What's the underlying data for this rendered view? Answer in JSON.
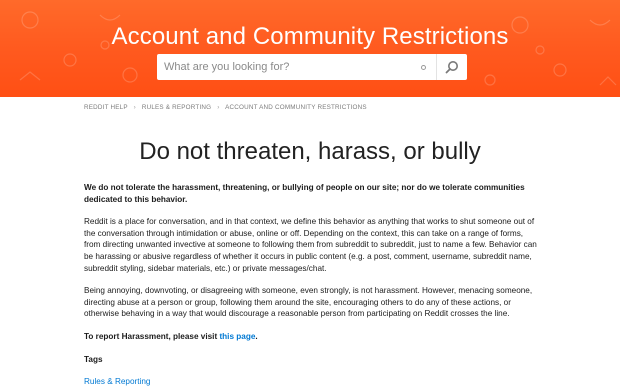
{
  "hero": {
    "title": "Account and Community Restrictions",
    "search_placeholder": "What are you looking for?",
    "search_icon": "magnifier-icon",
    "accent": "#ff5a1f"
  },
  "breadcrumb": {
    "items": [
      "REDDIT HELP",
      "RULES & REPORTING",
      "ACCOUNT AND COMMUNITY RESTRICTIONS"
    ],
    "separator": "›"
  },
  "article": {
    "title": "Do not threaten, harass, or bully",
    "lead": "We do not tolerate the harassment, threatening, or bullying of people on our site; nor do we tolerate communities dedicated to this behavior.",
    "paragraph1": "Reddit is a place for conversation, and in that context, we define this behavior as anything that works to shut someone out of the conversation through intimidation or abuse, online or off. Depending on the context, this can take on a range of forms, from directing unwanted invective at someone to following them from subreddit to subreddit, just to name a few. Behavior can be harassing or abusive regardless of whether it occurs in public content (e.g. a post, comment, username, subreddit name, subreddit styling, sidebar materials, etc.) or private messages/chat.",
    "paragraph2": "Being annoying, downvoting, or disagreeing with someone, even strongly, is not harassment. However, menacing someone, directing abuse at a person or group, following them around the site, encouraging others to do any of these actions, or otherwise behaving in a way that would discourage a reasonable person from participating on Reddit crosses the line.",
    "report_prefix": "To report Harassment, please visit ",
    "report_link": "this page",
    "report_suffix": ".",
    "link_color": "#0079d3"
  },
  "tags": {
    "heading": "Tags",
    "items": [
      "Rules & Reporting"
    ]
  }
}
